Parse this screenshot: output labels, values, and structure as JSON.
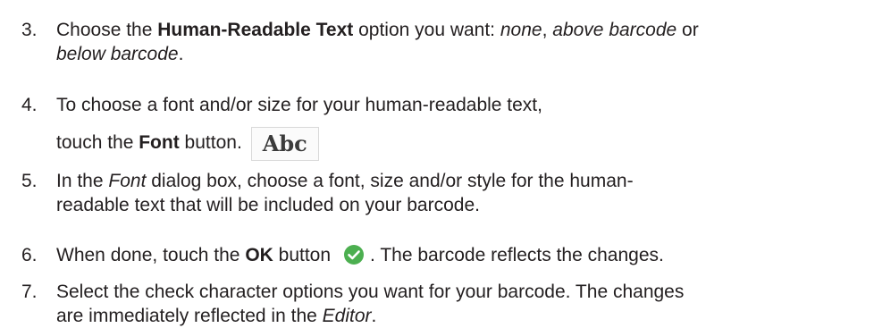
{
  "steps": [
    {
      "number": "3.",
      "line1_a": "Choose the ",
      "line1_bold": "Human-Readable Text",
      "line1_b": " option you want: ",
      "opt1": "none",
      "comma": ",",
      "opt2": "above barcode",
      "or": " or",
      "opt3": "below barcode",
      "end": "."
    },
    {
      "number": "4.",
      "line1": "To choose a font and/or size for your human-readable text,",
      "line2_a": "touch the ",
      "line2_bold": "Font",
      "line2_b": " button.",
      "button_text": "Abc"
    },
    {
      "number": "5.",
      "line1_a": "In the ",
      "line1_italic": "Font",
      "line1_b": " dialog box, choose a font, size and/or style for the human-",
      "line2": "readable text that will be included on your barcode."
    },
    {
      "number": "6.",
      "a": "When done, touch the ",
      "bold": "OK",
      "b": " button",
      "c": ". The barcode reflects the changes.",
      "icon": "check-circle-icon",
      "icon_color": "#4caf50"
    },
    {
      "number": "7.",
      "line1": "Select the check character options you want for your barcode. The changes",
      "line2_a": "are immediately reflected in the ",
      "line2_italic": "Editor",
      "line2_b": "."
    }
  ]
}
